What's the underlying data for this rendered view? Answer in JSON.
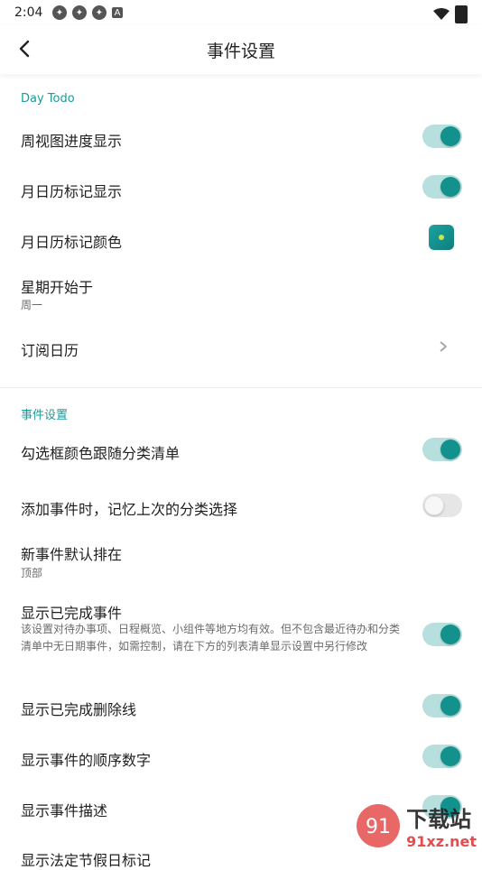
{
  "status_bar": {
    "time": "2:04",
    "icons": [
      "app-icon",
      "app-icon",
      "app-icon",
      "notification-a-icon"
    ],
    "right_icons": [
      "wifi-icon",
      "battery-icon"
    ]
  },
  "appbar": {
    "title": "事件设置",
    "back_icon": "chevron-left-icon"
  },
  "sections": [
    {
      "title": "Day Todo",
      "rows": [
        {
          "label": "周视图进度显示",
          "control": "toggle",
          "on": true
        },
        {
          "label": "月日历标记显示",
          "control": "toggle",
          "on": true
        },
        {
          "label": "月日历标记颜色",
          "control": "color",
          "color": "#13918d"
        },
        {
          "label": "星期开始于",
          "sub": "周一",
          "control": "none"
        },
        {
          "label": "订阅日历",
          "control": "chevron"
        }
      ]
    },
    {
      "title": "事件设置",
      "rows": [
        {
          "label": "勾选框颜色跟随分类清单",
          "control": "toggle",
          "on": true
        },
        {
          "label": "添加事件时，记忆上次的分类选择",
          "control": "toggle",
          "on": false
        },
        {
          "label": "新事件默认排在",
          "sub": "顶部",
          "control": "none"
        },
        {
          "label": "显示已完成事件",
          "desc": "该设置对待办事项、日程概览、小组件等地方均有效。但不包含最近待办和分类清单中无日期事件，如需控制，请在下方的列表清单显示设置中另行修改",
          "control": "toggle",
          "on": true
        },
        {
          "label": "显示已完成删除线",
          "control": "toggle",
          "on": true
        },
        {
          "label": "显示事件的顺序数字",
          "control": "toggle",
          "on": true
        },
        {
          "label": "显示事件描述",
          "control": "toggle",
          "on": true
        },
        {
          "label": "显示法定节假日标记",
          "control": "none"
        }
      ]
    }
  ],
  "colors": {
    "accent": "#13918d",
    "section_title": "#1a9a9a"
  },
  "watermark": {
    "text": "下载站",
    "site": "91xz.net"
  }
}
